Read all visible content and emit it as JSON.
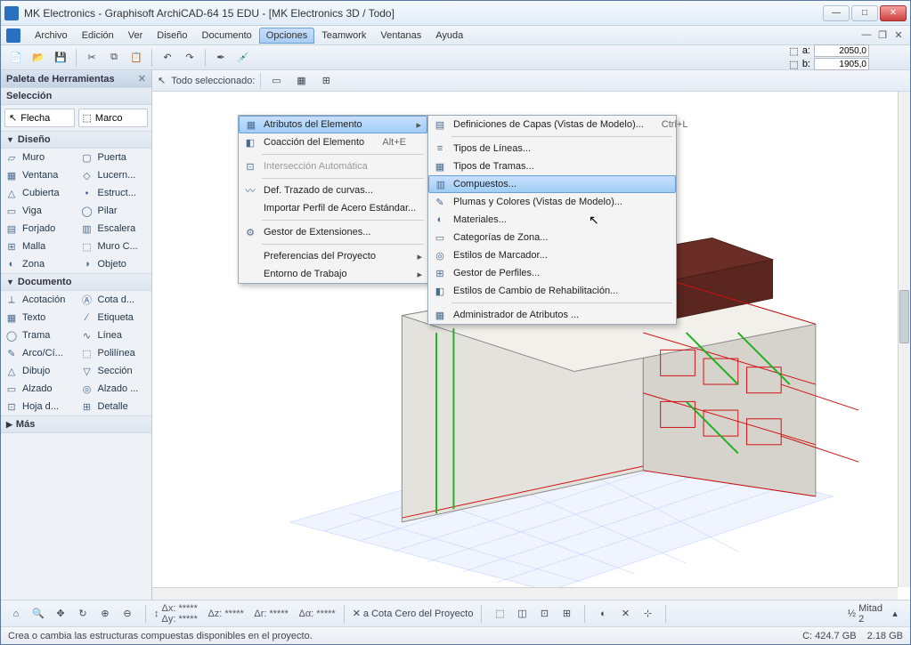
{
  "title": "MK Electronics - Graphisoft ArchiCAD-64 15 EDU - [MK Electronics 3D / Todo]",
  "menubar": [
    "Archivo",
    "Edición",
    "Ver",
    "Diseño",
    "Documento",
    "Opciones",
    "Teamwork",
    "Ventanas",
    "Ayuda"
  ],
  "menu_open_index": 5,
  "coords": {
    "a_label": "a:",
    "a": "2050,0",
    "b_label": "b:",
    "b": "1905,0"
  },
  "palette": {
    "title": "Paleta de Herramientas",
    "sec_sel": "Selección",
    "flecha": "Flecha",
    "marco": "Marco",
    "sec_dis": "Diseño",
    "items_dis": [
      {
        "l": "Muro",
        "r": "Puerta"
      },
      {
        "l": "Ventana",
        "r": "Lucern..."
      },
      {
        "l": "Cubierta",
        "r": "Estruct..."
      },
      {
        "l": "Viga",
        "r": "Pilar"
      },
      {
        "l": "Forjado",
        "r": "Escalera"
      },
      {
        "l": "Malla",
        "r": "Muro C..."
      },
      {
        "l": "Zona",
        "r": "Objeto"
      }
    ],
    "sec_doc": "Documento",
    "items_doc": [
      {
        "l": "Acotación",
        "r": "Cota d..."
      },
      {
        "l": "Texto",
        "r": "Etiqueta"
      },
      {
        "l": "Trama",
        "r": "Línea"
      },
      {
        "l": "Arco/Cí...",
        "r": "Polilínea"
      },
      {
        "l": "Dibujo",
        "r": "Sección"
      },
      {
        "l": "Alzado",
        "r": "Alzado ..."
      },
      {
        "l": "Hoja d...",
        "r": "Detalle"
      }
    ],
    "sec_mas": "Más"
  },
  "infobar": {
    "label": "Todo seleccionado:"
  },
  "dd1": [
    {
      "t": "Atributos del Elemento",
      "sub": true,
      "hl": true,
      "i": "▦"
    },
    {
      "t": "Coacción del Elemento",
      "sc": "Alt+E",
      "i": "◧"
    },
    {
      "sep": true
    },
    {
      "t": "Intersección Automática",
      "dis": true,
      "i": "⊡"
    },
    {
      "sep": true
    },
    {
      "t": "Def. Trazado de curvas...",
      "i": "〰"
    },
    {
      "t": "Importar Perfil de Acero Estándar..."
    },
    {
      "sep": true
    },
    {
      "t": "Gestor de Extensiones...",
      "i": "⚙"
    },
    {
      "sep": true
    },
    {
      "t": "Preferencias del Proyecto",
      "sub": true
    },
    {
      "t": "Entorno de Trabajo",
      "sub": true
    }
  ],
  "dd2": [
    {
      "t": "Definiciones de Capas (Vistas de Modelo)...",
      "sc": "Ctrl+L",
      "i": "▤"
    },
    {
      "sep": true
    },
    {
      "t": "Tipos de Líneas...",
      "i": "≡"
    },
    {
      "t": "Tipos de Tramas...",
      "i": "▦"
    },
    {
      "t": "Compuestos...",
      "hl": true,
      "i": "▥"
    },
    {
      "t": "Plumas y Colores (Vistas de Modelo)...",
      "i": "✎"
    },
    {
      "t": "Materiales...",
      "i": "◐"
    },
    {
      "t": "Categorías de Zona...",
      "i": "▭"
    },
    {
      "t": "Estilos de Marcador...",
      "i": "◎"
    },
    {
      "t": "Gestor de Perfiles...",
      "i": "⊞"
    },
    {
      "t": "Estilos de Cambio de Rehabilitación...",
      "i": "◧"
    },
    {
      "sep": true
    },
    {
      "t": "Administrador de Atributos ...",
      "i": "▦"
    }
  ],
  "bottom": {
    "dz": "Δz: *****",
    "dx": "Δx: *****",
    "dy": "Δy: *****",
    "dr": "Δr: *****",
    "da": "Δα: *****",
    "snap": "a Cota Cero del Proyecto",
    "scale_lbl": "Mitad",
    "scale_val": "2"
  },
  "status": {
    "hint": "Crea o cambia las estructuras compuestas disponibles en el proyecto.",
    "disk_c": "C: 424.7 GB",
    "ram": "2.18 GB"
  }
}
